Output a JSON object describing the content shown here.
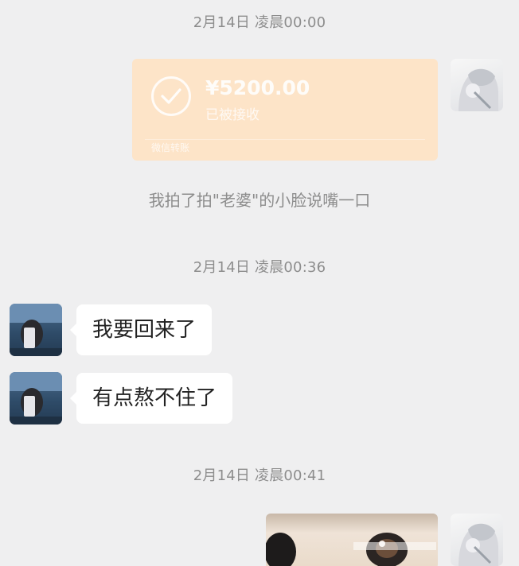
{
  "chat": {
    "timestamps": [
      "2月14日 凌晨00:00",
      "2月14日 凌晨00:36",
      "2月14日 凌晨00:41"
    ],
    "transfer": {
      "amount": "¥5200.00",
      "status": "已被接收",
      "footer": "微信转账",
      "accent_color": "#fde4c8"
    },
    "notice": "我拍了拍\"老婆\"的小脸说嘴一口",
    "messages": [
      {
        "sender": "other",
        "text": "我要回来了"
      },
      {
        "sender": "other",
        "text": "有点熬不住了"
      }
    ],
    "icons": {
      "received": "check-icon"
    }
  }
}
